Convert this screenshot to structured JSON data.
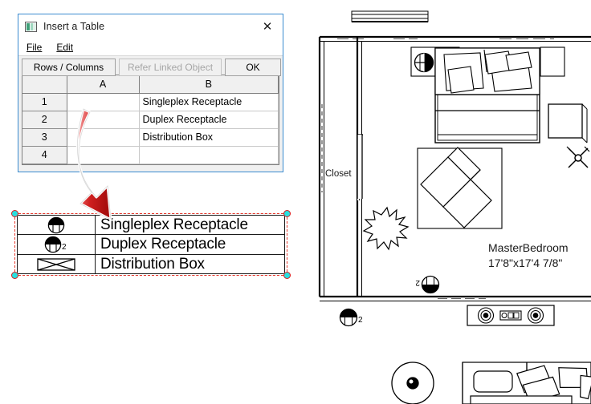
{
  "dialog": {
    "title": "Insert a Table",
    "icon": "table-app-icon",
    "close_label": "✕",
    "menu": [
      {
        "label": "File",
        "accel": "F"
      },
      {
        "label": "Edit",
        "accel": "E"
      }
    ],
    "buttons": [
      {
        "name": "rows-columns",
        "label": "Rows / Columns",
        "enabled": true
      },
      {
        "name": "refer-linked-object",
        "label": "Refer Linked Object",
        "enabled": false
      },
      {
        "name": "ok",
        "label": "OK",
        "enabled": true
      }
    ],
    "grid": {
      "corner_label": "",
      "column_headers": [
        "A",
        "B"
      ],
      "row_headers": [
        "1",
        "2",
        "3",
        "4"
      ],
      "rows": [
        {
          "a": "",
          "b": "Singleplex Receptacle"
        },
        {
          "a": "",
          "b": "Duplex Receptacle"
        },
        {
          "a": "",
          "b": "Distribution Box"
        },
        {
          "a": "",
          "b": ""
        }
      ]
    }
  },
  "annotation": {
    "arrow": "curved-down-right-arrow",
    "color": "#cc1c1c"
  },
  "legend_object": {
    "selected": true,
    "selection_color": "#e8382c",
    "handle_color": "#28e0e0",
    "rows": [
      {
        "symbol": "singleplex-receptacle-symbol",
        "label": "Singleplex Receptacle",
        "subscript": ""
      },
      {
        "symbol": "duplex-receptacle-symbol",
        "label": "Duplex Receptacle",
        "subscript": "2"
      },
      {
        "symbol": "distribution-box-symbol",
        "label": "Distribution Box",
        "subscript": ""
      }
    ]
  },
  "floorplan": {
    "rooms": [
      {
        "name": "MasterBedroom",
        "dimensions": "17'8\"x17'4 7/8\""
      },
      {
        "name": "Closet",
        "dimensions": ""
      }
    ],
    "symbols": [
      "duplex-receptacle-symbol",
      "duplex-receptacle-symbol",
      "duplex-receptacle-symbol",
      "duplex-receptacle-symbol",
      "ceiling-light-symbol",
      "ceiling-light-symbol",
      "ceiling-fan-symbol",
      "outlet-strip-symbol"
    ],
    "furniture": [
      "bed",
      "pillow",
      "pillow",
      "pillow",
      "nightstand",
      "armchair",
      "ottoman",
      "plant",
      "sectional-sofa",
      "round-table",
      "side-table",
      "coffee-table"
    ]
  }
}
